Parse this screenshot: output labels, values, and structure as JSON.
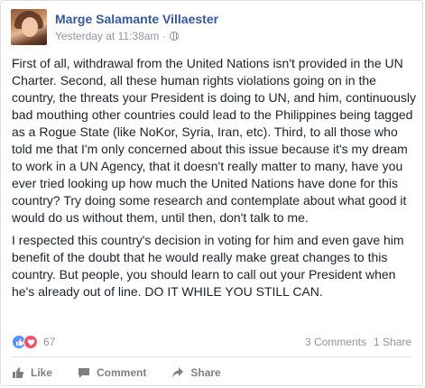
{
  "post": {
    "author": "Marge Salamante Villaester",
    "timestamp": "Yesterday at 11:38am",
    "separator": "·",
    "paragraphs": [
      "First of all, withdrawal from the United Nations isn't provided in the UN Charter. Second, all these human rights violations going on in the country, the threats your President is doing to UN, and him, continuously bad mouthing other countries could lead to the Philippines being tagged as a Rogue State (like NoKor, Syria, Iran, etc). Third, to all those who told me that I'm only concerned about this issue because it's my dream to work in a UN Agency, that it doesn't really matter to many, have you ever tried looking up how much the United Nations have done for this country? Try doing some research and contemplate about what good it would do us without them, until then, don't talk to me.",
      "I respected this country's decision in voting for him and even gave him benefit of the doubt that he would really make great changes to this country. But people, you should learn to call out your President when he's already out of line. DO IT WHILE YOU STILL CAN."
    ]
  },
  "stats": {
    "reaction_count": "67",
    "comments": "3 Comments",
    "shares": "1 Share"
  },
  "actions": {
    "like": "Like",
    "comment": "Comment",
    "share": "Share"
  },
  "icons": {
    "privacy": "globe-icon",
    "reaction_like": "thumbs-up-icon",
    "reaction_love": "heart-icon",
    "like": "thumbs-up-icon",
    "comment": "speech-bubble-icon",
    "share": "share-arrow-icon"
  },
  "colors": {
    "author": "#365899",
    "meta": "#90949c",
    "like_reaction": "#5890ff",
    "love_reaction": "#f25268"
  }
}
